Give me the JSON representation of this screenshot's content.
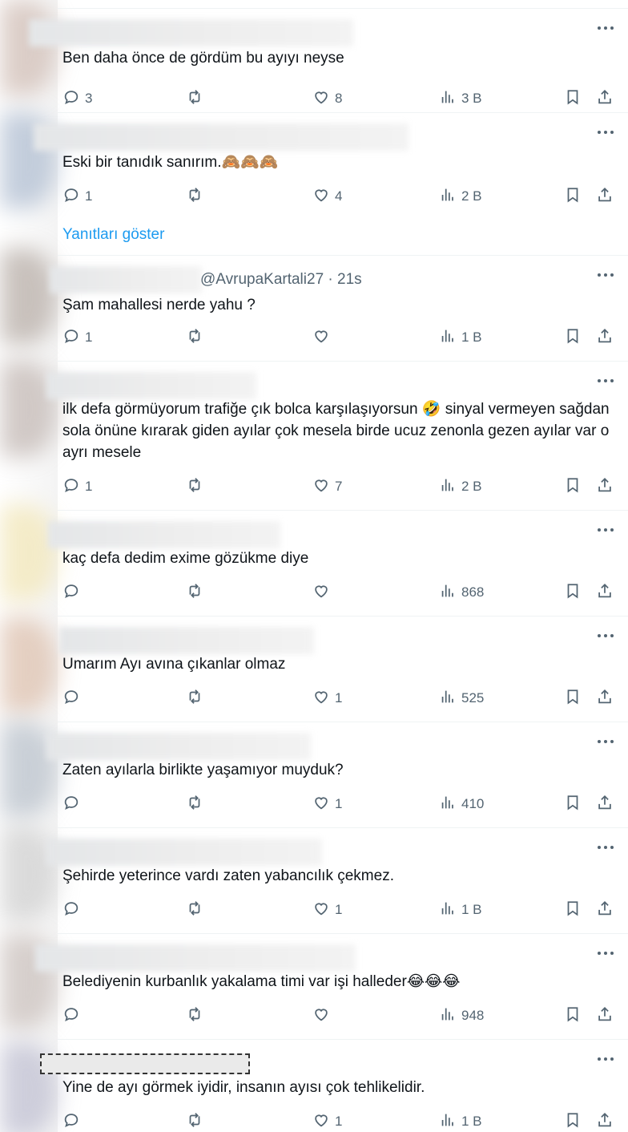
{
  "show_replies_label": "Yanıtları göster",
  "tweets": [
    {
      "handle": "",
      "text": "Ben daha önce de gördüm bu ayıyı neyse",
      "replies": "3",
      "retweets": "",
      "likes": "8",
      "views": "3 B"
    },
    {
      "handle": "",
      "text": "Eski bir tanıdık sanırım.",
      "text_emoji": "🙈🙈🙈",
      "replies": "1",
      "retweets": "",
      "likes": "4",
      "views": "2 B"
    },
    {
      "handle": "@AvrupaKartali27 · 21s",
      "text": "Şam mahallesi nerde yahu ?",
      "replies": "1",
      "retweets": "",
      "likes": "",
      "views": "1 B"
    },
    {
      "handle": "",
      "text": "ilk defa görmüyorum trafiğe çık bolca karşılaşıyorsun 🤣 sinyal vermeyen sağdan sola önüne kırarak giden ayılar çok mesela birde ucuz zenonla gezen ayılar var o ayrı mesele",
      "replies": "1",
      "retweets": "",
      "likes": "7",
      "views": "2 B"
    },
    {
      "handle": "",
      "text": "kaç defa dedim exime gözükme diye",
      "replies": "",
      "retweets": "",
      "likes": "",
      "views": "868"
    },
    {
      "handle": "",
      "text": "Umarım Ayı avına çıkanlar olmaz",
      "replies": "",
      "retweets": "",
      "likes": "1",
      "views": "525"
    },
    {
      "handle": "",
      "text": "Zaten ayılarla birlikte yaşamıyor muyduk?",
      "replies": "",
      "retweets": "",
      "likes": "1",
      "views": "410"
    },
    {
      "handle": "",
      "text": "Şehirde yeterince vardı zaten yabancılık çekmez.",
      "replies": "",
      "retweets": "",
      "likes": "1",
      "views": "1 B"
    },
    {
      "handle": "",
      "text": "Belediyenin kurbanlık yakalama timi var işi halleder",
      "text_emoji": "😂😂😂",
      "replies": "",
      "retweets": "",
      "likes": "",
      "views": "948"
    },
    {
      "handle": "",
      "text": "Yine de ayı görmek iyidir, insanın ayısı çok tehlikelidir.",
      "replies": "",
      "retweets": "",
      "likes": "1",
      "views": "1 B"
    }
  ],
  "icons": {
    "reply": "reply-icon",
    "retweet": "retweet-icon",
    "like": "heart-icon",
    "views": "views-icon",
    "bookmark": "bookmark-icon",
    "share": "share-icon",
    "more": "more-icon"
  },
  "colors": {
    "text": "#0f1419",
    "secondary": "#536471",
    "link": "#1d9bf0"
  }
}
